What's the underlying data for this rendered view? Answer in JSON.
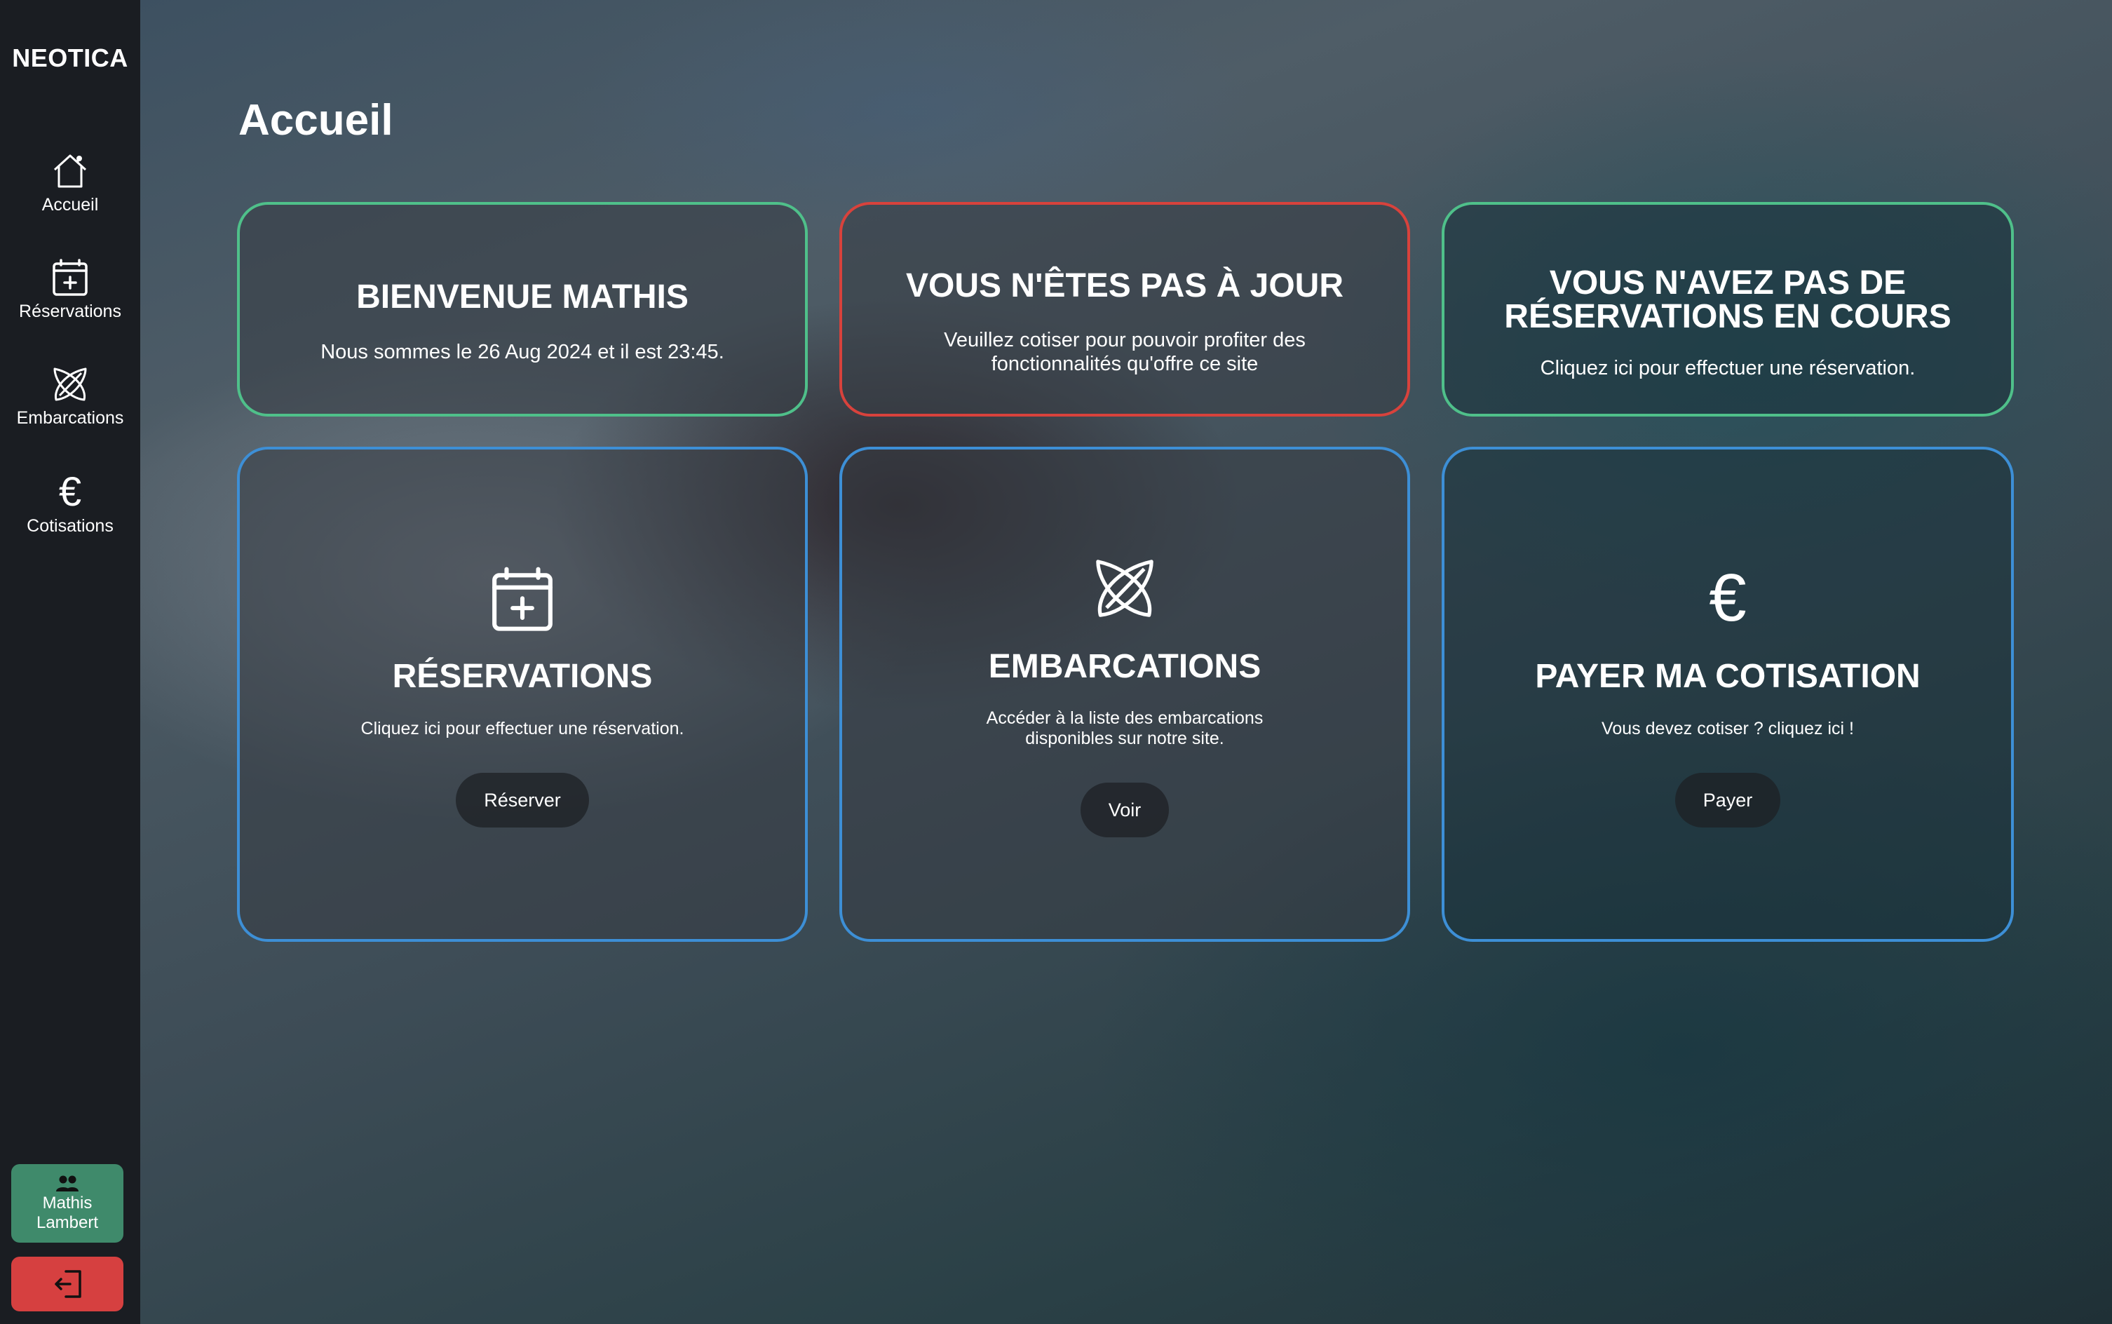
{
  "sidebar": {
    "brand": "NEOTICA",
    "items": [
      {
        "label": "Accueil",
        "icon": "home-icon"
      },
      {
        "label": "Réservations",
        "icon": "calendar-plus-icon"
      },
      {
        "label": "Embarcations",
        "icon": "surfboards-icon"
      },
      {
        "label": "Cotisations",
        "icon": "euro-icon",
        "glyph": "€"
      }
    ],
    "user": {
      "first_name": "Mathis",
      "last_name": "Lambert",
      "icon": "users-icon"
    },
    "logout_icon": "logout-icon"
  },
  "page": {
    "title": "Accueil"
  },
  "cards": {
    "welcome": {
      "title": "BIENVENUE MATHIS",
      "text": "Nous sommes le 26 Aug 2024 et il est 23:45."
    },
    "status": {
      "title": "VOUS N'ÊTES PAS À JOUR",
      "text_line1": "Veuillez cotiser pour pouvoir profiter des",
      "text_line2": "fonctionnalités qu'offre ce site"
    },
    "no_reservation": {
      "title_line1": "VOUS N'AVEZ PAS DE",
      "title_line2": "RÉSERVATIONS EN COURS",
      "text": "Cliquez ici pour effectuer une réservation."
    },
    "reservations": {
      "title": "RÉSERVATIONS",
      "text": "Cliquez ici pour effectuer une réservation.",
      "button": "Réserver"
    },
    "embarcations": {
      "title": "EMBARCATIONS",
      "text_line1": "Accéder à la liste des embarcations",
      "text_line2": "disponibles sur notre site.",
      "button": "Voir"
    },
    "cotisation": {
      "title": "PAYER MA COTISATION",
      "text": "Vous devez cotiser ? cliquez ici !",
      "button": "Payer",
      "glyph": "€"
    }
  },
  "colors": {
    "success_border": "#4fc08a",
    "danger_border": "#d8423c",
    "info_border": "#3d8fd6",
    "user_button": "#3f8a6b",
    "logout_button": "#d64040",
    "sidebar_bg": "#1a1d22"
  }
}
